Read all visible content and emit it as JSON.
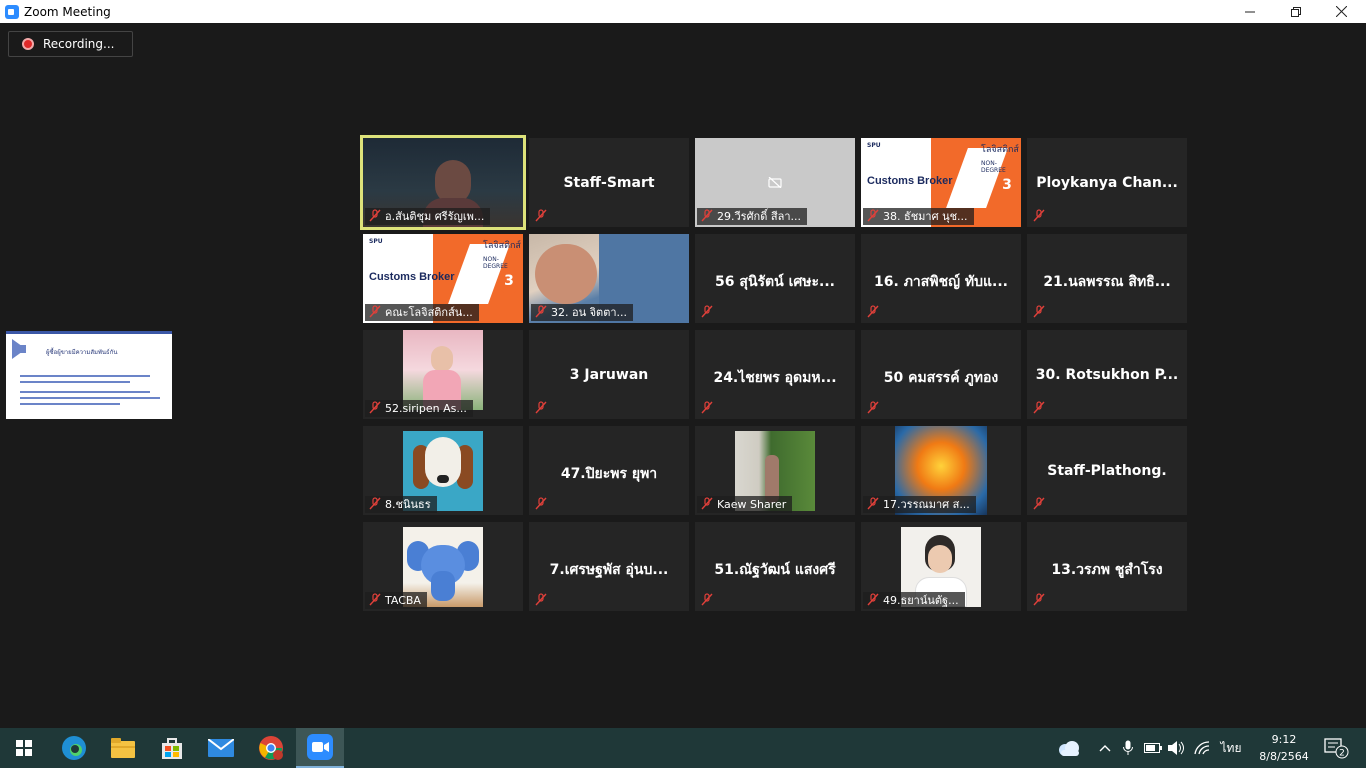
{
  "window": {
    "title": "Zoom Meeting"
  },
  "recording": {
    "label": "Recording..."
  },
  "share_thumb": {
    "title": "ผู้ซื้อผู้ขายมีความสัมพันธ์กัน"
  },
  "slide": {
    "logo": "SPU",
    "thai": "โลจิสติกส์",
    "nondegree": "NON-DEGREE",
    "brand": "Customs Broker",
    "round": "3"
  },
  "tiles": [
    {
      "label": "อ.สันติชุม ศรีรัญเพ..."
    },
    {
      "center": "Staff-Smart"
    },
    {
      "label": "29.วีรศักดิ์ สีลา..."
    },
    {
      "label": "38. ธัชมาศ นุช..."
    },
    {
      "center": "Ploykanya  Chan..."
    },
    {
      "label": "คณะโลจิสติกส์น..."
    },
    {
      "label": "32. อน จิตตา..."
    },
    {
      "center": "56 สุนิรัตน์ เศษะ..."
    },
    {
      "center": "16. ภาสพิชญ์ ทับแ..."
    },
    {
      "center": "21.นลพรรณ สิทธิ..."
    },
    {
      "label": "52.siripen As..."
    },
    {
      "center": "3 Jaruwan"
    },
    {
      "center": "24.ไชยพร อุดมห..."
    },
    {
      "center": "50 คมสรรค์ ภูทอง"
    },
    {
      "center": "30. Rotsukhon P..."
    },
    {
      "label": "8.ชนินธร"
    },
    {
      "center": "47.ปิยะพร ยุพา"
    },
    {
      "label": "Kaew Sharer"
    },
    {
      "label": "17.วรรณมาศ ส..."
    },
    {
      "center": "Staff-Plathong."
    },
    {
      "label": "TACBA"
    },
    {
      "center": "7.เศรษฐพัส อุ่นบ..."
    },
    {
      "center": "51.ณัฐวัฒน์ แสงศรี"
    },
    {
      "label": "49.ธยาน์นตัฐ..."
    },
    {
      "center": "13.วรภพ ชูสำโรง"
    }
  ],
  "tray": {
    "lang": "ไทย",
    "time": "9:12",
    "date": "8/8/2564",
    "notifications": "2"
  }
}
